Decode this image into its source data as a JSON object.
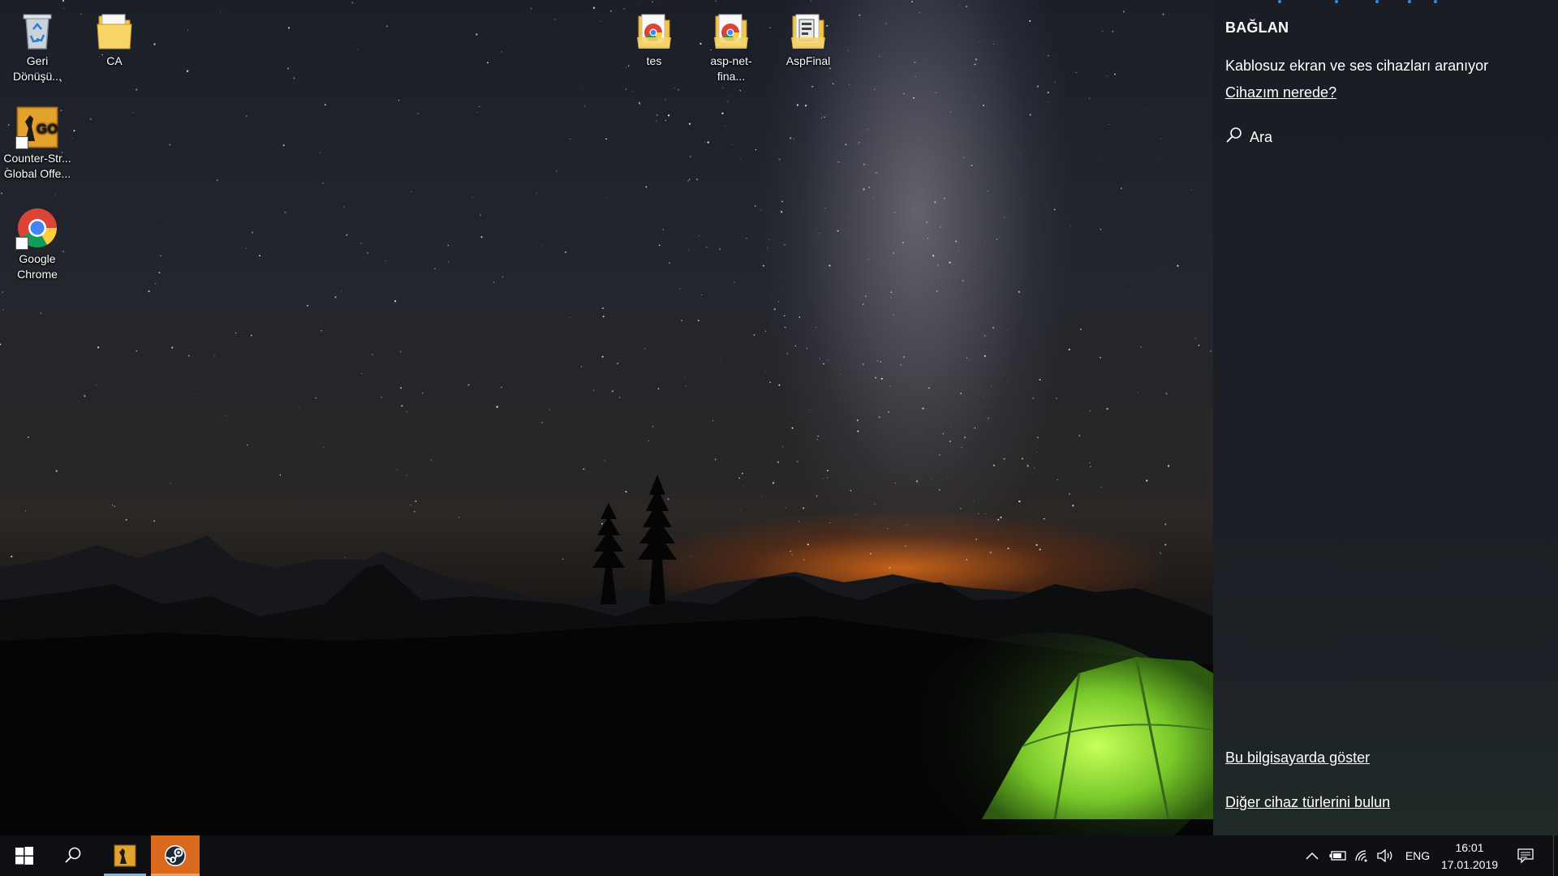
{
  "desktop": {
    "icons": [
      {
        "label": "Geri Dönüşü...",
        "icon": "recycle-bin-icon"
      },
      {
        "label": "CA",
        "icon": "folder-icon"
      },
      {
        "label": "Counter-Str... Global Offe...",
        "icon": "csgo-icon"
      },
      {
        "label": "Google Chrome",
        "icon": "chrome-icon"
      },
      {
        "label": "tes",
        "icon": "chrome-folder-icon"
      },
      {
        "label": "asp-net-fina...",
        "icon": "chrome-folder-icon"
      },
      {
        "label": "AspFinal",
        "icon": "folder-icon"
      }
    ]
  },
  "connect_panel": {
    "title": "BAĞLAN",
    "status": "Kablosuz ekran ve ses cihazları aranıyor",
    "where_link": "Cihazım nerede?",
    "search_label": "Ara",
    "show_on_pc_link": "Bu bilgisayarda göster",
    "other_devices_link": "Diğer cihaz türlerini bulun",
    "accent_color": "#2d8fe6"
  },
  "taskbar": {
    "start_icon": "windows-logo-icon",
    "search_icon": "search-icon",
    "pinned_apps": [
      {
        "name": "Counter-Strike: Global Offensive",
        "icon": "csgo-icon",
        "active": true
      },
      {
        "name": "Steam",
        "icon": "steam-icon",
        "active": true
      }
    ],
    "tray": {
      "language": "ENG",
      "time": "16:01",
      "date": "17.01.2019"
    }
  }
}
